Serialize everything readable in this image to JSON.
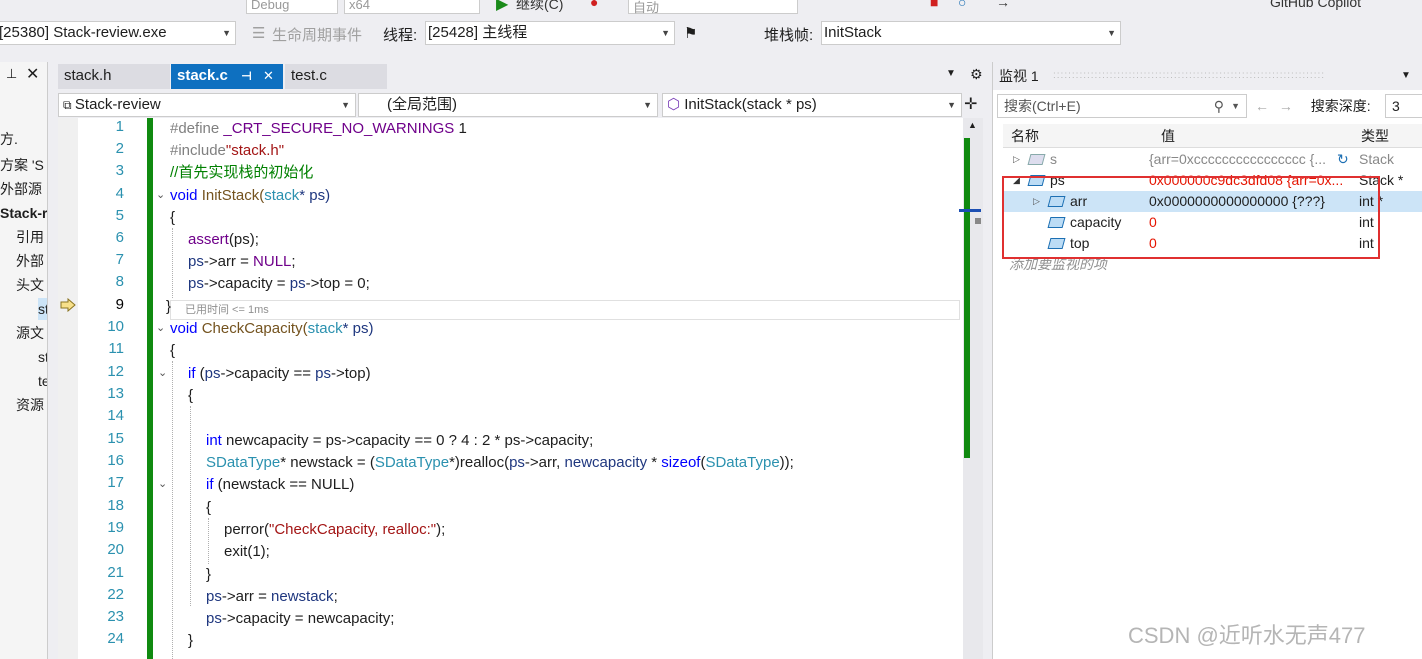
{
  "toolbar1": {
    "config": "Debug",
    "platform": "x64",
    "continue_label": "继续(C)",
    "auto": "自动",
    "copilot": "GitHub Copilot"
  },
  "toolbar2": {
    "process": "[25380] Stack-review.exe",
    "lifecycle": "生命周期事件",
    "thread_label": "线程:",
    "thread": "[25428] 主线程",
    "stackframe_label": "堆栈帧:",
    "stackframe": "InitStack"
  },
  "solution": {
    "rows": [
      "方.",
      "方案 'S",
      "外部源",
      "Stack-r",
      "引用",
      "外部",
      "头文",
      "st",
      "源文",
      "st",
      "te",
      "资源"
    ]
  },
  "editor": {
    "tabs": [
      {
        "label": "stack.h",
        "active": false
      },
      {
        "label": "stack.c",
        "active": true
      },
      {
        "label": "test.c",
        "active": false
      }
    ],
    "nav": {
      "project": "Stack-review",
      "scope": "(全局范围)",
      "function": "InitStack(stack * ps)"
    },
    "elapsed": "已用时间 <= 1ms",
    "line_numbers": [
      "1",
      "2",
      "3",
      "4",
      "5",
      "6",
      "7",
      "8",
      "9",
      "10",
      "11",
      "12",
      "13",
      "14",
      "15",
      "16",
      "17",
      "18",
      "19",
      "20",
      "21",
      "22",
      "23",
      "24"
    ],
    "current_line": "9",
    "code": {
      "l1_a": "#define ",
      "l1_b": "_CRT_SECURE_NO_WARNINGS",
      "l1_c": " 1",
      "l2_a": "#include",
      "l2_b": "\"stack.h\"",
      "l3": "//首先实现栈的初始化",
      "l4_a": "void",
      "l4_b": " InitStack(",
      "l4_c": "stack",
      "l4_d": "* ps)",
      "l5": "{",
      "l6_a": "assert",
      "l6_b": "(ps);",
      "l7_a": "ps",
      "l7_b": "->arr = ",
      "l7_c": "NULL",
      "l7_d": ";",
      "l8_a": "ps",
      "l8_b": "->capacity = ",
      "l8_c": "ps",
      "l8_d": "->top = 0;",
      "l9": "}",
      "l10_a": "void",
      "l10_b": " CheckCapacity(",
      "l10_c": "stack",
      "l10_d": "* ps)",
      "l11": "{",
      "l12_a": "if",
      "l12_b": " (",
      "l12_c": "ps",
      "l12_d": "->capacity == ",
      "l12_e": "ps",
      "l12_f": "->top)",
      "l13": "{",
      "l15_a": "int",
      "l15_b": " newcapacity = ps->capacity == 0 ? 4 : 2 * ps->capacity;",
      "l16_a": "SDataType",
      "l16_b": "* newstack = (",
      "l16_c": "SDataType",
      "l16_d": "*)realloc(",
      "l16_e": "ps",
      "l16_f": "->arr, ",
      "l16_g": "newcapacity",
      "l16_h": " * ",
      "l16_i": "sizeof",
      "l16_j": "(",
      "l16_k": "SDataType",
      "l16_l": "));",
      "l17_a": "if",
      "l17_b": " (newstack == NULL)",
      "l18": "{",
      "l19_a": "perror(",
      "l19_b": "\"CheckCapacity, realloc:\"",
      "l19_c": ");",
      "l20": "exit(1);",
      "l21": "}",
      "l22_a": "ps",
      "l22_b": "->arr = ",
      "l22_c": "newstack",
      "l22_d": ";",
      "l23_a": "ps",
      "l23_b": "->capacity = newcapacity;",
      "l24": "}"
    }
  },
  "watch": {
    "title": "监视 1",
    "search_placeholder": "搜索(Ctrl+E)",
    "depth_label": "搜索深度:",
    "depth": "3",
    "columns": {
      "name": "名称",
      "value": "值",
      "type": "类型"
    },
    "rows": [
      {
        "name": "s",
        "value": "{arr=0xcccccccccccccccc {...",
        "type": "Stack"
      },
      {
        "name": "ps",
        "value": "0x000000c9dc3dfd08 {arr=0x...",
        "type": "Stack *"
      },
      {
        "name": "arr",
        "value": "0x0000000000000000 {???}",
        "type": "int *"
      },
      {
        "name": "capacity",
        "value": "0",
        "type": "int"
      },
      {
        "name": "top",
        "value": "0",
        "type": "int"
      }
    ],
    "add_watch": "添加要监视的项"
  },
  "watermark": "CSDN @近听水无声477"
}
